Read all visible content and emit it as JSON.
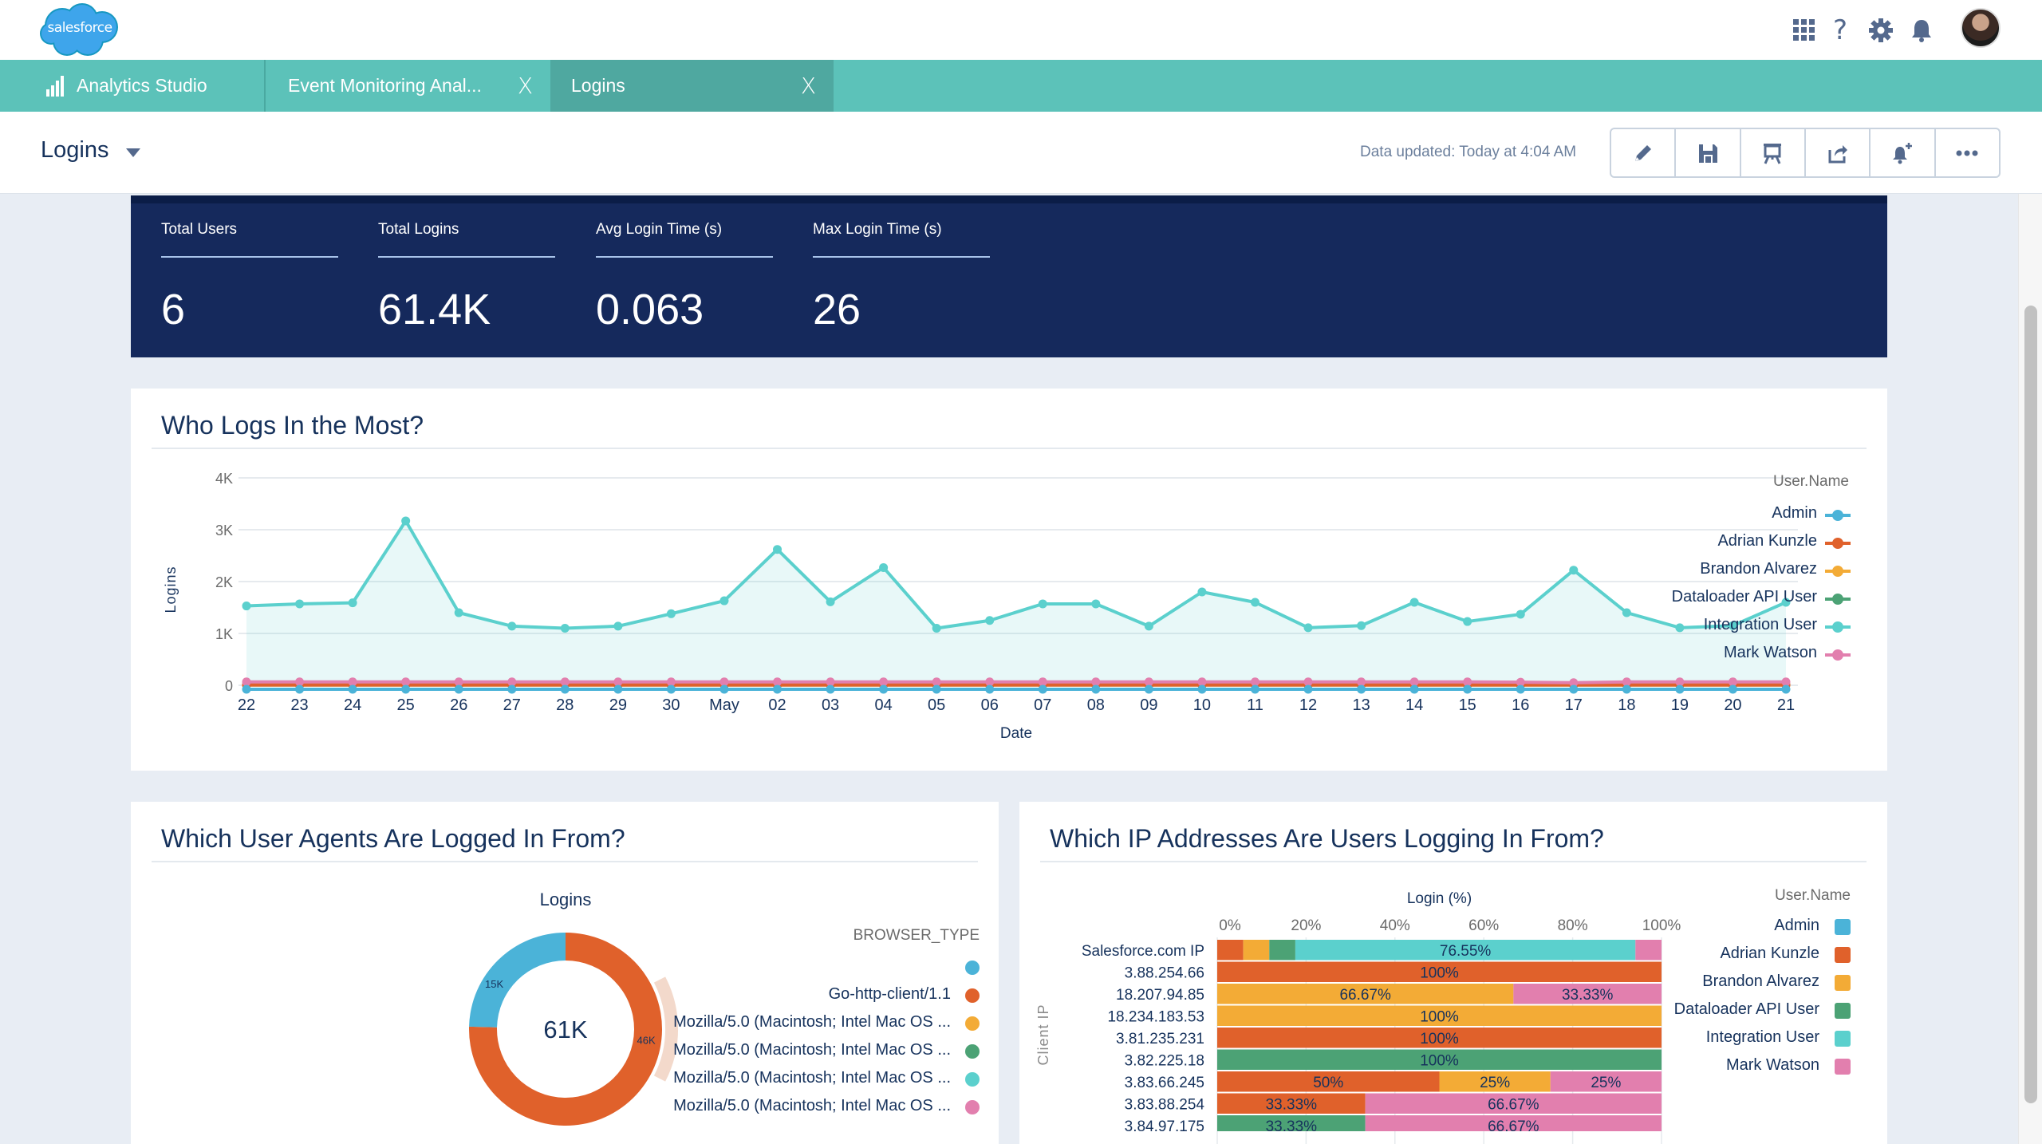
{
  "app": {
    "logo_text": "salesforce",
    "header_icons": [
      "app-launcher-icon",
      "help-icon",
      "settings-icon",
      "notifications-icon"
    ]
  },
  "tabs": [
    {
      "label": "Analytics Studio",
      "icon": "bar-chart-icon",
      "closable": false,
      "active": false
    },
    {
      "label": "Event Monitoring Anal...",
      "closable": true,
      "active": false
    },
    {
      "label": "Logins",
      "closable": true,
      "active": true
    }
  ],
  "tab_close_glyph": "X",
  "dashboard": {
    "title": "Logins",
    "data_updated": "Data updated: Today at 4:04 AM",
    "toolbar": [
      "edit-icon",
      "save-icon",
      "presentation-icon",
      "share-icon",
      "notification-add-icon",
      "more-icon"
    ]
  },
  "kpis": [
    {
      "label": "Total Users",
      "value": "6"
    },
    {
      "label": "Total Logins",
      "value": "61.4K"
    },
    {
      "label": "Avg Login Time (s)",
      "value": "0.063"
    },
    {
      "label": "Max Login Time (s)",
      "value": "26"
    }
  ],
  "colors": {
    "admin": "#4bb3d8",
    "adrian": "#e0612b",
    "brandon": "#f3ab36",
    "dataloader": "#4ca275",
    "integration": "#5bd0cd",
    "mark": "#e27fae",
    "teal_bar": "#5cc2b9",
    "kpi_bg": "#15295c"
  },
  "chart_data": [
    {
      "id": "who-logs-in",
      "type": "line",
      "title": "Who Logs In the Most?",
      "xlabel": "Date",
      "ylabel": "Logins",
      "ylim": [
        0,
        4000
      ],
      "yticks": [
        0,
        1000,
        2000,
        3000,
        4000
      ],
      "ytick_labels": [
        "0",
        "1K",
        "2K",
        "3K",
        "4K"
      ],
      "grid": true,
      "legend_title": "User.Name",
      "legend_position": "right",
      "x": [
        "22",
        "23",
        "24",
        "25",
        "26",
        "27",
        "28",
        "29",
        "30",
        "May",
        "02",
        "03",
        "04",
        "05",
        "06",
        "07",
        "08",
        "09",
        "10",
        "11",
        "12",
        "13",
        "14",
        "15",
        "16",
        "17",
        "18",
        "19",
        "20",
        "21"
      ],
      "series": [
        {
          "name": "Admin",
          "color_key": "admin",
          "values": [
            0,
            0,
            0,
            0,
            0,
            0,
            0,
            0,
            0,
            0,
            0,
            0,
            0,
            0,
            0,
            0,
            0,
            0,
            0,
            0,
            0,
            0,
            0,
            0,
            0,
            0,
            0,
            0,
            0,
            0
          ]
        },
        {
          "name": "Adrian Kunzle",
          "color_key": "adrian",
          "values": [
            5,
            5,
            5,
            5,
            5,
            5,
            5,
            5,
            5,
            5,
            5,
            5,
            5,
            5,
            5,
            5,
            5,
            5,
            5,
            5,
            5,
            5,
            5,
            5,
            5,
            5,
            5,
            5,
            5,
            5
          ]
        },
        {
          "name": "Brandon Alvarez",
          "color_key": "brandon",
          "values": [
            5,
            5,
            5,
            5,
            5,
            5,
            5,
            5,
            5,
            5,
            5,
            5,
            5,
            5,
            5,
            5,
            5,
            5,
            5,
            5,
            5,
            5,
            5,
            5,
            5,
            5,
            5,
            5,
            5,
            5
          ]
        },
        {
          "name": "Dataloader API User",
          "color_key": "dataloader",
          "values": [
            5,
            5,
            5,
            5,
            5,
            5,
            5,
            5,
            5,
            5,
            5,
            5,
            5,
            5,
            5,
            5,
            5,
            5,
            5,
            5,
            5,
            5,
            5,
            5,
            5,
            5,
            5,
            5,
            5,
            5
          ]
        },
        {
          "name": "Integration User",
          "color_key": "integration",
          "values": [
            1530,
            1570,
            1590,
            3170,
            1400,
            1140,
            1100,
            1140,
            1380,
            1630,
            2620,
            1610,
            2270,
            1100,
            1250,
            1570,
            1570,
            1140,
            1800,
            1600,
            1110,
            1150,
            1600,
            1230,
            1370,
            2220,
            1400,
            1110,
            1150,
            1600
          ],
          "area": true
        },
        {
          "name": "Mark Watson",
          "color_key": "mark",
          "values": [
            65,
            65,
            65,
            65,
            65,
            65,
            65,
            65,
            65,
            65,
            65,
            65,
            65,
            65,
            65,
            65,
            65,
            65,
            65,
            65,
            65,
            65,
            65,
            65,
            60,
            50,
            65,
            65,
            65,
            65
          ]
        }
      ]
    },
    {
      "id": "user-agents",
      "type": "pie",
      "donut": true,
      "title": "Which User Agents Are Logged In From?",
      "subtitle": "Logins",
      "center_label": "61K",
      "legend_title": "BROWSER_TYPE",
      "legend_position": "right",
      "slices": [
        {
          "label": "Go-http-client/1.1",
          "value": 46000,
          "data_label": "46K",
          "color_key": "adrian"
        },
        {
          "label": "",
          "value": 15000,
          "data_label": "15K",
          "color_key": "admin"
        }
      ],
      "legend": [
        {
          "label": "",
          "color_key": "admin"
        },
        {
          "label": "Go-http-client/1.1",
          "color_key": "adrian"
        },
        {
          "label": "Mozilla/5.0 (Macintosh; Intel Mac OS ...",
          "color_key": "brandon"
        },
        {
          "label": "Mozilla/5.0 (Macintosh; Intel Mac OS ...",
          "color_key": "dataloader"
        },
        {
          "label": "Mozilla/5.0 (Macintosh; Intel Mac OS ...",
          "color_key": "integration"
        },
        {
          "label": "Mozilla/5.0 (Macintosh; Intel Mac OS ...",
          "color_key": "mark"
        }
      ]
    },
    {
      "id": "ip-addresses",
      "type": "bar",
      "orientation": "horizontal",
      "stacked": "percent",
      "title": "Which IP Addresses Are Users Logging In From?",
      "xlabel": "Login (%)",
      "ylabel": "Client IP",
      "xlim": [
        0,
        100
      ],
      "xticks": [
        0,
        20,
        40,
        60,
        80,
        100
      ],
      "xtick_labels": [
        "0%",
        "20%",
        "40%",
        "60%",
        "80%",
        "100%"
      ],
      "legend_title": "User.Name",
      "legend_position": "right",
      "legend": [
        {
          "label": "Admin",
          "color_key": "admin"
        },
        {
          "label": "Adrian Kunzle",
          "color_key": "adrian"
        },
        {
          "label": "Brandon Alvarez",
          "color_key": "brandon"
        },
        {
          "label": "Dataloader API User",
          "color_key": "dataloader"
        },
        {
          "label": "Integration User",
          "color_key": "integration"
        },
        {
          "label": "Mark Watson",
          "color_key": "mark"
        }
      ],
      "categories": [
        "Salesforce.com IP",
        "3.88.254.66",
        "18.207.94.85",
        "18.234.183.53",
        "3.81.235.231",
        "3.82.225.18",
        "3.83.66.245",
        "3.83.88.254",
        "3.84.97.175"
      ],
      "rows": [
        [
          {
            "user": "adrian",
            "pct": 5.86
          },
          {
            "user": "brandon",
            "pct": 5.86
          },
          {
            "user": "dataloader",
            "pct": 5.86
          },
          {
            "user": "integration",
            "pct": 76.55,
            "label": "76.55%"
          },
          {
            "user": "mark",
            "pct": 5.87
          }
        ],
        [
          {
            "user": "adrian",
            "pct": 100,
            "label": "100%"
          }
        ],
        [
          {
            "user": "brandon",
            "pct": 66.67,
            "label": "66.67%"
          },
          {
            "user": "mark",
            "pct": 33.33,
            "label": "33.33%"
          }
        ],
        [
          {
            "user": "brandon",
            "pct": 100,
            "label": "100%"
          }
        ],
        [
          {
            "user": "adrian",
            "pct": 100,
            "label": "100%"
          }
        ],
        [
          {
            "user": "dataloader",
            "pct": 100,
            "label": "100%"
          }
        ],
        [
          {
            "user": "adrian",
            "pct": 50,
            "label": "50%"
          },
          {
            "user": "brandon",
            "pct": 25,
            "label": "25%"
          },
          {
            "user": "mark",
            "pct": 25,
            "label": "25%"
          }
        ],
        [
          {
            "user": "adrian",
            "pct": 33.33,
            "label": "33.33%"
          },
          {
            "user": "mark",
            "pct": 66.67,
            "label": "66.67%"
          }
        ],
        [
          {
            "user": "dataloader",
            "pct": 33.33,
            "label": "33.33%"
          },
          {
            "user": "mark",
            "pct": 66.67,
            "label": "66.67%"
          }
        ]
      ]
    }
  ]
}
